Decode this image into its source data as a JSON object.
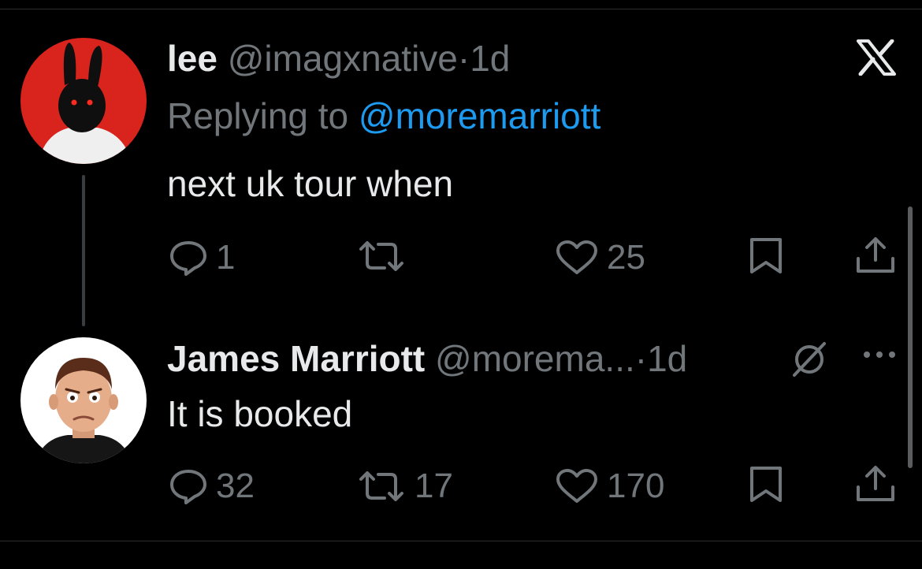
{
  "tweets": [
    {
      "name": "lee",
      "handle": "@imagxnative",
      "separator": "·",
      "time": "1d",
      "replying_prefix": "Replying to",
      "replying_to": "@moremarriott",
      "text": "next uk tour when",
      "actions": {
        "replies": "1",
        "retweets": "",
        "likes": "25"
      }
    },
    {
      "name": "James Marriott",
      "handle": "@morema...",
      "separator": "·",
      "time": "1d",
      "text": "It is booked",
      "actions": {
        "replies": "32",
        "retweets": "17",
        "likes": "170"
      }
    }
  ],
  "icons": {
    "close": "x-logo-icon",
    "hide": "hide-reply-icon",
    "more": "more-options-icon",
    "reply": "reply-icon",
    "retweet": "retweet-icon",
    "like": "heart-icon",
    "bookmark": "bookmark-icon",
    "share": "share-icon"
  },
  "colors": {
    "background": "#000000",
    "text": "#e7e9ea",
    "secondary": "#71767b",
    "link": "#1d9bf0"
  }
}
